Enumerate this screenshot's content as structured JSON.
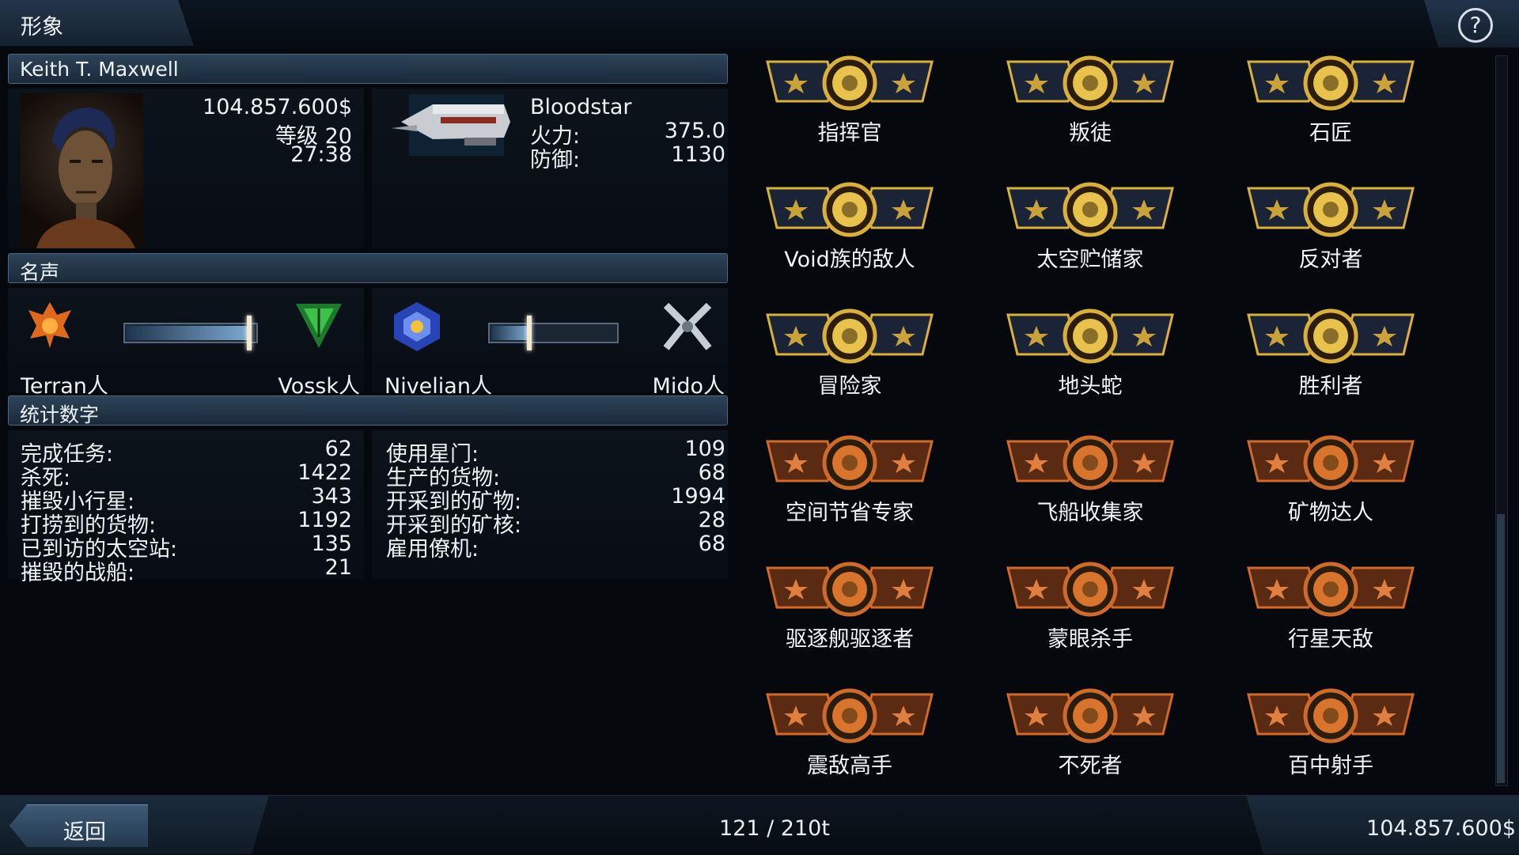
{
  "header": {
    "title": "形象",
    "help_icon": "?"
  },
  "profile": {
    "name": "Keith T. Maxwell",
    "money": "104.857.600$",
    "level": "等级 20",
    "time": "27:38",
    "portrait_icon": "pilot-portrait"
  },
  "ship": {
    "name": "Bloodstar",
    "firepower_label": "火力:",
    "firepower_value": "375.0",
    "defense_label": "防御:",
    "defense_value": "1130"
  },
  "reputation": {
    "title": "名声",
    "pairs": [
      {
        "left": "Terran人",
        "right": "Vossk人",
        "level": 0.95,
        "left_icon": "terran-emblem-icon",
        "right_icon": "vossk-emblem-icon"
      },
      {
        "left": "Nivelian人",
        "right": "Mido人",
        "level": 0.3,
        "left_icon": "nivelian-emblem-icon",
        "right_icon": "mido-emblem-icon"
      }
    ]
  },
  "stats": {
    "title": "统计数字",
    "left": [
      {
        "label": "完成任务:",
        "value": "62"
      },
      {
        "label": "杀死:",
        "value": "1422"
      },
      {
        "label": "摧毁小行星:",
        "value": "343"
      },
      {
        "label": "打捞到的货物:",
        "value": "1192"
      },
      {
        "label": "已到访的太空站:",
        "value": "135"
      },
      {
        "label": "摧毁的战船:",
        "value": "21"
      }
    ],
    "right": [
      {
        "label": "使用星门:",
        "value": "109"
      },
      {
        "label": "生产的货物:",
        "value": "68"
      },
      {
        "label": "开采到的矿物:",
        "value": "1994"
      },
      {
        "label": "开采到的矿核:",
        "value": "28"
      },
      {
        "label": "雇用僚机:",
        "value": "68"
      }
    ]
  },
  "achievements": [
    {
      "label": "指挥官",
      "tier": "gold",
      "icon": "commander-icon"
    },
    {
      "label": "叛徒",
      "tier": "gold",
      "icon": "traitor-icon"
    },
    {
      "label": "石匠",
      "tier": "gold",
      "icon": "mason-icon"
    },
    {
      "label": "Void族的敌人",
      "tier": "gold",
      "icon": "peace-sign-icon"
    },
    {
      "label": "太空贮储家",
      "tier": "gold",
      "icon": "cube-icon"
    },
    {
      "label": "反对者",
      "tier": "gold",
      "icon": "cross-icon"
    },
    {
      "label": "冒险家",
      "tier": "gold",
      "icon": "fist-icon"
    },
    {
      "label": "地头蛇",
      "tier": "gold",
      "icon": "star-badge-icon"
    },
    {
      "label": "胜利者",
      "tier": "gold",
      "icon": "trophy-icon"
    },
    {
      "label": "空间节省专家",
      "tier": "bronze",
      "icon": "crate-icon"
    },
    {
      "label": "飞船收集家",
      "tier": "bronze",
      "icon": "parking-icon"
    },
    {
      "label": "矿物达人",
      "tier": "bronze",
      "icon": "mineral-icon"
    },
    {
      "label": "驱逐舰驱逐者",
      "tier": "bronze",
      "icon": "eagle-icon"
    },
    {
      "label": "蒙眼杀手",
      "tier": "bronze",
      "icon": "striped-ship-icon"
    },
    {
      "label": "行星天敌",
      "tier": "bronze",
      "icon": "planet-icon"
    },
    {
      "label": "震敌高手",
      "tier": "bronze",
      "icon": "shockwave-icon"
    },
    {
      "label": "不死者",
      "tier": "bronze",
      "icon": "tombstone-icon"
    },
    {
      "label": "百中射手",
      "tier": "bronze",
      "icon": "sniper-icon"
    }
  ],
  "footer": {
    "back_label": "返回",
    "cargo": "121 / 210t",
    "money": "104.857.600$"
  },
  "colors": {
    "gold": "#d9b13a",
    "bronze": "#c8642a",
    "panel": "#0c131b",
    "header": "#2d4358"
  }
}
